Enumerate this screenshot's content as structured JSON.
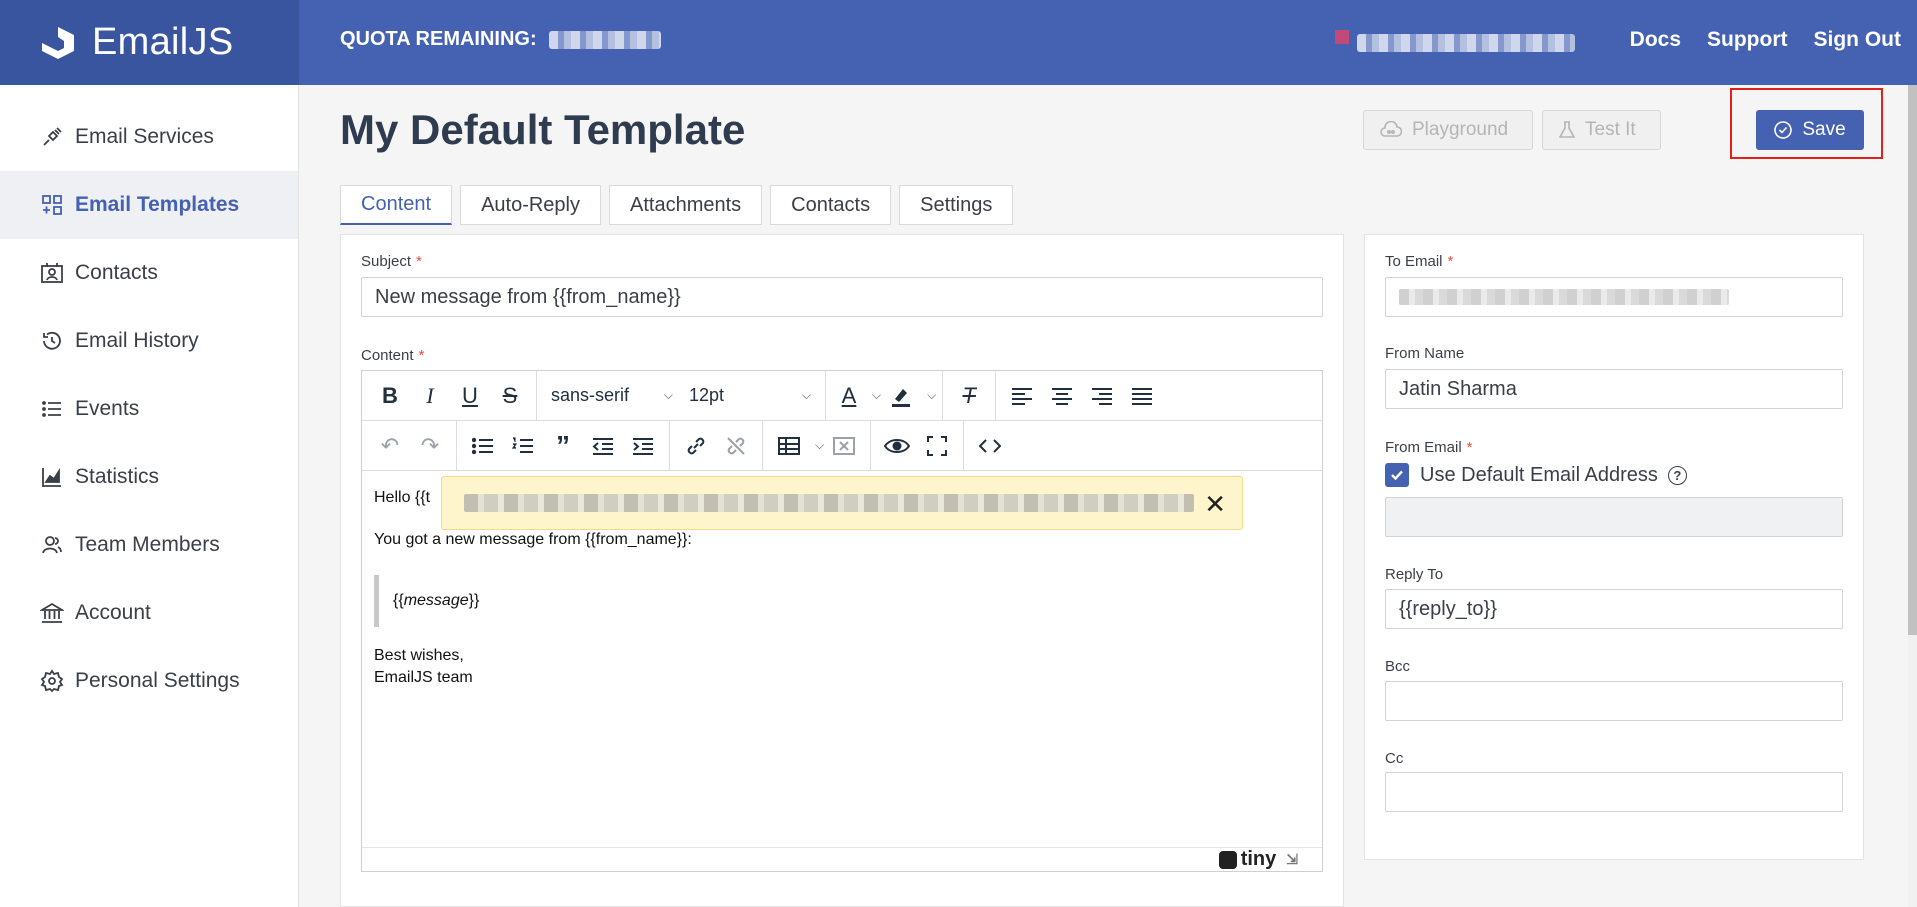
{
  "app": {
    "brand": "EmailJS",
    "quota_label": "QUOTA REMAINING:",
    "top_links": [
      "Docs",
      "Support",
      "Sign Out"
    ]
  },
  "sidebar": {
    "items": [
      {
        "label": "Email Services",
        "icon": "plug-icon",
        "active": false
      },
      {
        "label": "Email Templates",
        "icon": "templates-icon",
        "active": true
      },
      {
        "label": "Contacts",
        "icon": "contacts-icon",
        "active": false
      },
      {
        "label": "Email History",
        "icon": "history-icon",
        "active": false
      },
      {
        "label": "Events",
        "icon": "list-icon",
        "active": false
      },
      {
        "label": "Statistics",
        "icon": "chart-icon",
        "active": false
      },
      {
        "label": "Team Members",
        "icon": "team-icon",
        "active": false
      },
      {
        "label": "Account",
        "icon": "bank-icon",
        "active": false
      },
      {
        "label": "Personal Settings",
        "icon": "gear-icon",
        "active": false
      }
    ]
  },
  "header": {
    "title": "My Default Template",
    "playground_label": "Playground",
    "test_label": "Test It",
    "save_label": "Save"
  },
  "tabs": [
    "Content",
    "Auto-Reply",
    "Attachments",
    "Contacts",
    "Settings"
  ],
  "form": {
    "subject_label": "Subject",
    "subject_value": "New message from {{from_name}}",
    "content_label": "Content",
    "font_family": "sans-serif",
    "font_size": "12pt",
    "editor": {
      "line1": "Hello {{t",
      "line2": "You got a new message from {{from_name}}:",
      "quote_prefix": "{{",
      "quote_var": "message",
      "quote_suffix": "}}",
      "sign1": "Best wishes,",
      "sign2": "EmailJS team",
      "brand": "tiny"
    }
  },
  "right_panel": {
    "to_email_label": "To Email",
    "from_name_label": "From Name",
    "from_name_value": "Jatin Sharma",
    "from_email_label": "From Email",
    "use_default_label": "Use Default Email Address",
    "reply_to_label": "Reply To",
    "reply_to_value": "{{reply_to}}",
    "bcc_label": "Bcc",
    "cc_label": "Cc"
  },
  "colors": {
    "brand_blue": "#4461b2",
    "brand_dark": "#3a559f",
    "required": "#e74c3c",
    "highlight": "#e2211c"
  }
}
